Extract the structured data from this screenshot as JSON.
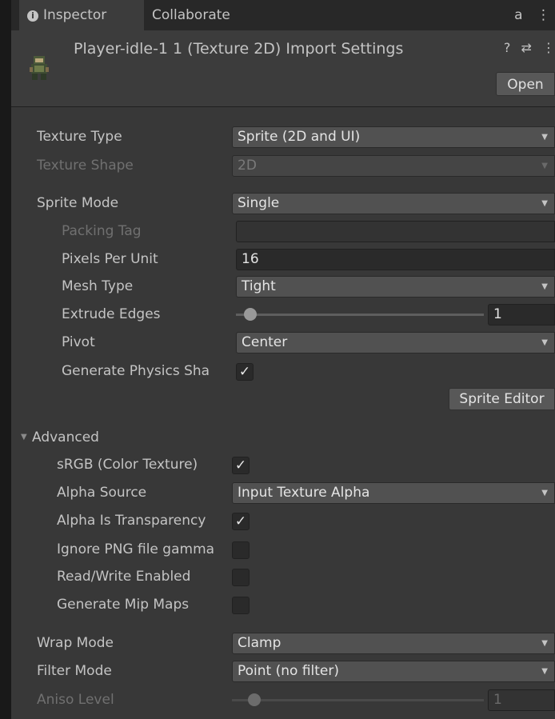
{
  "tabs": [
    {
      "label": "Inspector",
      "icon": "info-icon"
    },
    {
      "label": "Collaborate"
    }
  ],
  "tab_icons": {
    "lock": "a",
    "menu": "⋮"
  },
  "header": {
    "title": "Player-idle-1 1 (Texture 2D) Import Settings",
    "help_icon": "?",
    "preset_icon": "⇄",
    "menu_icon": "⋮",
    "open_label": "Open"
  },
  "fields": {
    "texture_type": {
      "label": "Texture Type",
      "value": "Sprite (2D and UI)"
    },
    "texture_shape": {
      "label": "Texture Shape",
      "value": "2D"
    },
    "sprite_mode": {
      "label": "Sprite Mode",
      "value": "Single"
    },
    "packing_tag": {
      "label": "Packing Tag",
      "value": ""
    },
    "pixels_per_unit": {
      "label": "Pixels Per Unit",
      "value": "16"
    },
    "mesh_type": {
      "label": "Mesh Type",
      "value": "Tight"
    },
    "extrude_edges": {
      "label": "Extrude Edges",
      "value": "1"
    },
    "pivot": {
      "label": "Pivot",
      "value": "Center"
    },
    "generate_physics_shape": {
      "label": "Generate Physics Sha",
      "checked": true
    },
    "sprite_editor_label": "Sprite Editor",
    "advanced_label": "Advanced",
    "srgb": {
      "label": "sRGB (Color Texture)",
      "checked": true
    },
    "alpha_source": {
      "label": "Alpha Source",
      "value": "Input Texture Alpha"
    },
    "alpha_is_transparency": {
      "label": "Alpha Is Transparency",
      "checked": true
    },
    "ignore_png_gamma": {
      "label": "Ignore PNG file gamma",
      "checked": false
    },
    "read_write": {
      "label": "Read/Write Enabled",
      "checked": false
    },
    "generate_mip_maps": {
      "label": "Generate Mip Maps",
      "checked": false
    },
    "wrap_mode": {
      "label": "Wrap Mode",
      "value": "Clamp"
    },
    "filter_mode": {
      "label": "Filter Mode",
      "value": "Point (no filter)"
    },
    "aniso_level": {
      "label": "Aniso Level",
      "value": "1"
    }
  },
  "glyphs": {
    "check": "✓",
    "dropdown_arrow": "▼",
    "foldout_arrow": "▼"
  },
  "colors": {
    "panel_bg": "#383838",
    "header_bg": "#3c3c3c",
    "tab_bg": "#282828"
  }
}
